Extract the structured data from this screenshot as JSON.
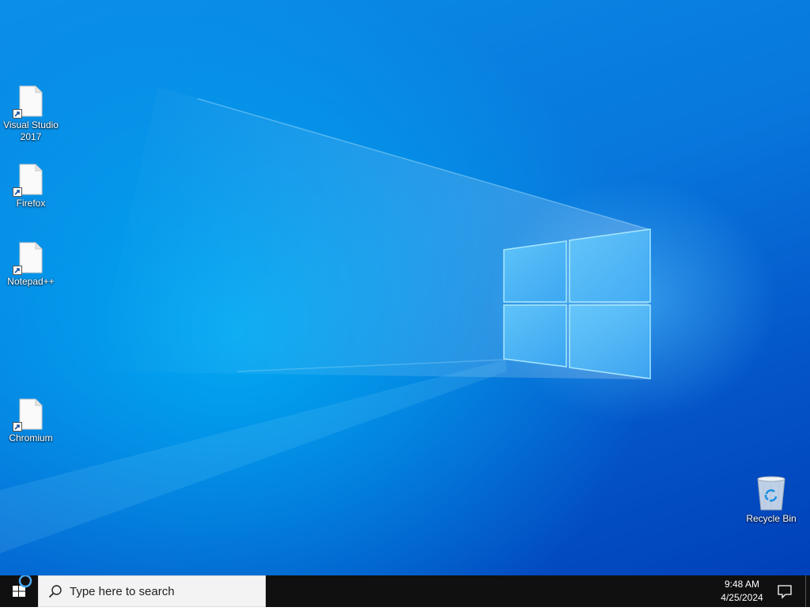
{
  "desktop": {
    "icons": [
      {
        "label": "Visual Studio 2017",
        "icon": "file-shortcut-icon"
      },
      {
        "label": "Firefox",
        "icon": "file-shortcut-icon"
      },
      {
        "label": "Notepad++",
        "icon": "file-shortcut-icon"
      },
      {
        "label": "Chromium",
        "icon": "file-shortcut-icon"
      },
      {
        "label": "Recycle Bin",
        "icon": "recycle-bin-icon"
      }
    ],
    "wallpaper": {
      "primary_color": "#0877dc",
      "light_color": "#5ac8ff"
    }
  },
  "taskbar": {
    "start_icon": "windows-logo-icon",
    "search": {
      "placeholder": "Type here to search",
      "icon": "search-icon"
    },
    "clock": {
      "time": "9:48 AM",
      "date": "4/25/2024"
    },
    "notification_icon": "action-center-icon",
    "background_color": "#101010"
  }
}
